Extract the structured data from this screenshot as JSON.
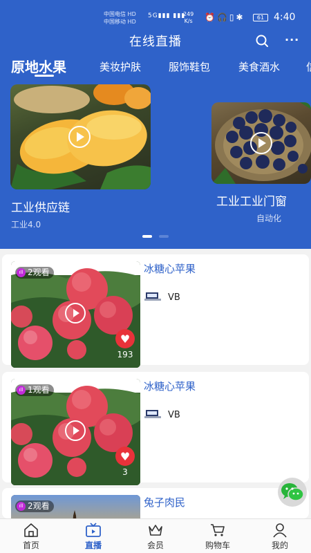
{
  "status_bar": {
    "carrier1": "中国电信",
    "carrier2": "中国移动",
    "hd": "HD",
    "net": "5G",
    "speed_value": "249",
    "speed_unit": "K/s",
    "battery": "61",
    "time": "4:40"
  },
  "header": {
    "title": "在线直播"
  },
  "tabs": [
    "原地水果",
    "美妆护肤",
    "服饰鞋包",
    "美食酒水",
    "信"
  ],
  "banners": [
    {
      "title": "工业供应链",
      "subtitle": "工业4.0"
    },
    {
      "title": "工业工业门窗",
      "subtitle": "自动化"
    }
  ],
  "streams": [
    {
      "viewers": "2观看",
      "title": "冰糖心苹果",
      "seller": "VB",
      "likes": "193"
    },
    {
      "viewers": "1观看",
      "title": "冰糖心苹果",
      "seller": "VB",
      "likes": "3"
    },
    {
      "viewers": "2观看",
      "title": "兔子肉民",
      "seller": "",
      "likes": ""
    }
  ],
  "bottom_nav": [
    {
      "label": "首页",
      "icon": "home-icon"
    },
    {
      "label": "直播",
      "icon": "tv-icon"
    },
    {
      "label": "会员",
      "icon": "crown-icon"
    },
    {
      "label": "购物车",
      "icon": "cart-icon"
    },
    {
      "label": "我的",
      "icon": "user-icon"
    }
  ],
  "colors": {
    "accent": "#2f62c9",
    "heart": "#e8323a",
    "live": "#c02ad8"
  }
}
